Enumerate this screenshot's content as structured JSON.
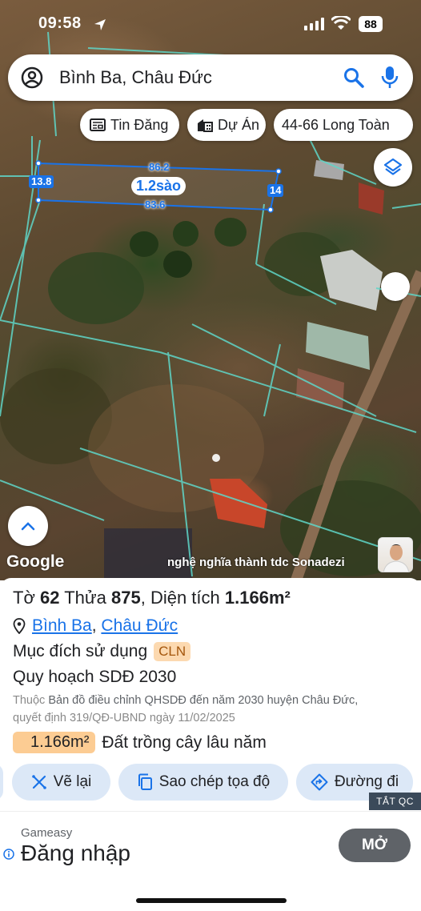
{
  "status_bar": {
    "time": "09:58",
    "battery": "88"
  },
  "search": {
    "query": "Bình Ba, Châu Đức"
  },
  "chips": [
    {
      "label": "Tin Đăng",
      "icon": "newspaper-icon"
    },
    {
      "label": "Dự Án",
      "icon": "buildings-icon"
    },
    {
      "label": "44-66 Long Toàn",
      "icon": ""
    }
  ],
  "map": {
    "area_label": "1.2sào",
    "measurements": {
      "top": "86.2",
      "bottom": "83.6",
      "left": "13.8",
      "right": "14"
    },
    "google_logo": "Google",
    "watermark": "nghệ nghĩa thành tdc Sonadezi"
  },
  "parcel": {
    "to_label": "Tờ",
    "to_value": "62",
    "thua_label": "Thửa",
    "thua_value": "875",
    "area_label": "Diện tích",
    "area_value": "1.166m²",
    "ward": "Bình Ba",
    "district": "Châu Đức",
    "purpose_label": "Mục đích sử dụng",
    "purpose_code": "CLN",
    "plan_title": "Quy hoạch SDĐ 2030",
    "plan_desc_prefix": "Thuộc",
    "plan_desc_main": "Bản đồ điều chỉnh QHSDĐ đến năm 2030 huyện Châu Đức,",
    "plan_desc_decision": "quyết định 319/QĐ-UBND ngày 11/02/2025",
    "land_area": "1.166m²",
    "land_type": "Đất trồng cây lâu năm"
  },
  "actions": [
    {
      "label": "Vẽ lại",
      "icon": "redraw-icon"
    },
    {
      "label": "Sao chép tọa độ",
      "icon": "copy-icon"
    },
    {
      "label": "Đường đi",
      "icon": "directions-icon"
    }
  ],
  "ad": {
    "close_label": "TẮT QC",
    "advertiser": "Gameasy",
    "headline": "Đăng nhập",
    "cta": "MỞ"
  },
  "colors": {
    "accent": "#1a73e8",
    "tag_bg": "#fcd9b0",
    "land_bg": "#fccc93",
    "action_bg": "#dce8f7"
  }
}
